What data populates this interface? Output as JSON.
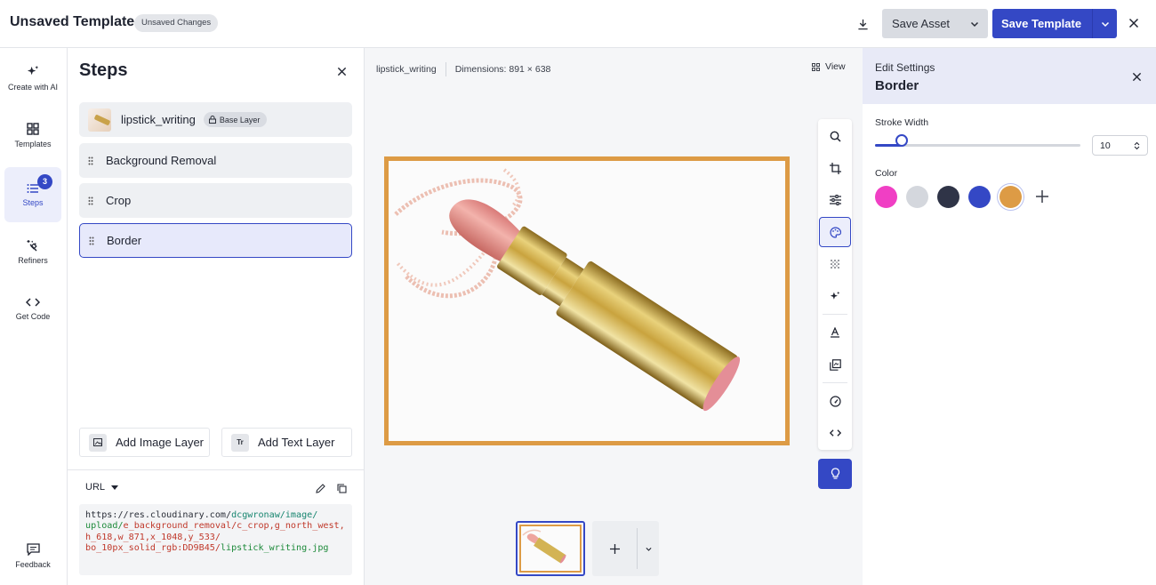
{
  "header": {
    "title": "Unsaved Template",
    "badge": "Unsaved Changes",
    "save_asset": "Save Asset",
    "save_template": "Save Template"
  },
  "nav": {
    "items": [
      {
        "label": "Create with AI",
        "icon": "sparkles-icon"
      },
      {
        "label": "Templates",
        "icon": "grid-icon"
      },
      {
        "label": "Steps",
        "icon": "list-icon",
        "badge": "3"
      },
      {
        "label": "Refiners",
        "icon": "magic-wand-icon"
      },
      {
        "label": "Get Code",
        "icon": "code-icon"
      },
      {
        "label": "Feedback",
        "icon": "chat-icon"
      }
    ]
  },
  "steps": {
    "title": "Steps",
    "base": {
      "label": "lipstick_writing",
      "badge": "Base Layer"
    },
    "items": [
      "Background Removal",
      "Crop",
      "Border"
    ],
    "active": "Border",
    "add_image": "Add Image Layer",
    "add_text": "Add Text Layer",
    "add_text_icon": "Tr",
    "url_mode": "URL",
    "url": {
      "part1": "https://res.cloudinary.com/",
      "part2": "dcgwronaw/image/",
      "part3": "upload/",
      "part4": "e_background_removal/c_crop,g_north_west,",
      "part5": "h_618,w_871,x_1048,y_533/",
      "part6": "bo_10px_solid_rgb:DD9B45/",
      "part7": "lipstick_writing.jpg"
    }
  },
  "canvas": {
    "filename": "lipstick_writing",
    "dimensions": "Dimensions: 891 × 638",
    "view": "View",
    "border_color": "#DD9B45",
    "tools": [
      "search-icon",
      "crop-icon",
      "sliders-icon",
      "palette-icon",
      "pattern-icon",
      "sparkle-icon",
      "text-icon",
      "layers-icon",
      "gauge-icon",
      "code-icon"
    ],
    "active_tool": "palette-icon"
  },
  "settings": {
    "subtitle": "Edit Settings",
    "title": "Border",
    "stroke_label": "Stroke Width",
    "stroke_value": "10",
    "stroke_fraction": 0.13,
    "color_label": "Color",
    "colors": [
      "#F03FC4",
      "#D4D7DD",
      "#2F3447",
      "#3448C5",
      "#DD9B45"
    ],
    "selected_color": "#DD9B45"
  },
  "accent": "#3448C5"
}
